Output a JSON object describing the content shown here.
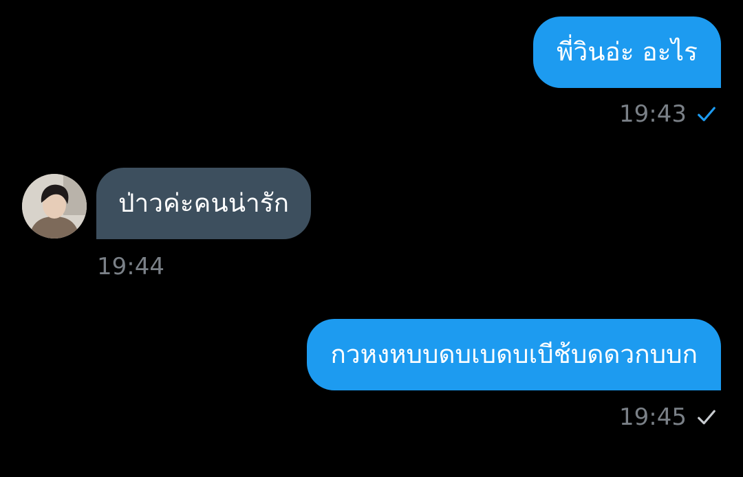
{
  "messages": [
    {
      "text": "พี่วินอ่ะ อะไร",
      "time": "19:43",
      "direction": "outgoing",
      "status": "read"
    },
    {
      "text": "ป่าวค่ะคนน่ารัก",
      "time": "19:44",
      "direction": "incoming"
    },
    {
      "text": "กวหงหบบดบเบดบเบีช้บดดวกบบก",
      "time": "19:45",
      "direction": "outgoing",
      "status": "sent"
    }
  ],
  "colors": {
    "outgoing_bubble": "#1d9bf0",
    "incoming_bubble": "#3d4f5e",
    "read_check": "#1d9bf0",
    "sent_check": "#c8ccd0",
    "timestamp": "#7a8087",
    "background": "#000000"
  },
  "icons": {
    "read_status": "check-icon",
    "sent_status": "check-icon",
    "avatar": "user-avatar"
  }
}
